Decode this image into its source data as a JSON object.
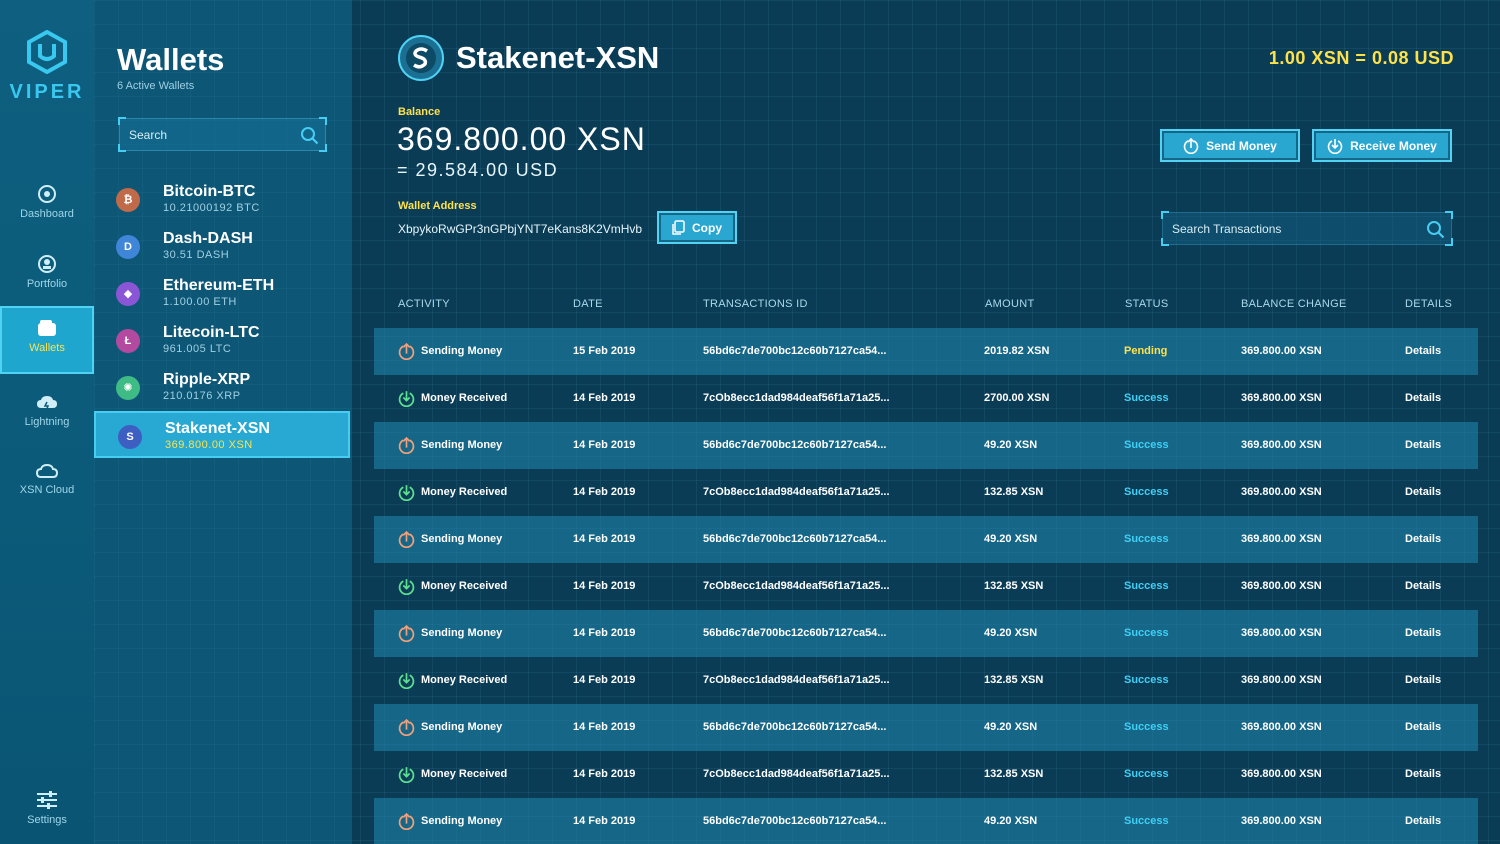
{
  "app": {
    "logo_text": "VIPER"
  },
  "nav": [
    {
      "label": "Dashboard",
      "icon": "dashboard-icon"
    },
    {
      "label": "Portfolio",
      "icon": "portfolio-icon"
    },
    {
      "label": "Wallets",
      "icon": "wallet-icon",
      "active": true
    },
    {
      "label": "Lightning",
      "icon": "lightning-cloud-icon"
    },
    {
      "label": "XSN Cloud",
      "icon": "cloud-icon"
    },
    {
      "label": "Settings",
      "icon": "sliders-icon"
    }
  ],
  "wallets": {
    "title": "Wallets",
    "subtitle": "6 Active Wallets",
    "search_placeholder": "Search",
    "items": [
      {
        "name": "Bitcoin-BTC",
        "balance": "10.21000192 BTC",
        "glyph": "₿",
        "color": "#c06a4a"
      },
      {
        "name": "Dash-DASH",
        "balance": "30.51 DASH",
        "glyph": "D",
        "color": "#3f86d9"
      },
      {
        "name": "Ethereum-ETH",
        "balance": "1.100.00 ETH",
        "glyph": "◆",
        "color": "#8b56d6"
      },
      {
        "name": "Litecoin-LTC",
        "balance": "961.005 LTC",
        "glyph": "Ł",
        "color": "#b34aa0"
      },
      {
        "name": "Ripple-XRP",
        "balance": "210.0176 XRP",
        "glyph": "✺",
        "color": "#3fbb86"
      },
      {
        "name": "Stakenet-XSN",
        "balance": "369.800.00 XSN",
        "glyph": "S",
        "color": "#3e5fc2",
        "active": true
      }
    ]
  },
  "header": {
    "coin_name": "Stakenet-XSN",
    "rate": "1.00 XSN = 0.08 USD"
  },
  "balance": {
    "label": "Balance",
    "amount": "369.800.00 XSN",
    "usd": "= 29.584.00 USD"
  },
  "address": {
    "label": "Wallet Address",
    "value": "XbpykoRwGPr3nGPbjYNT7eKans8K2VmHvb",
    "copy_label": "Copy"
  },
  "actions": {
    "send_label": "Send Money",
    "receive_label": "Receive Money"
  },
  "tx_search_placeholder": "Search Transactions",
  "table": {
    "headers": [
      "ACTIVITY",
      "DATE",
      "TRANSACTIONS ID",
      "AMOUNT",
      "STATUS",
      "BALANCE CHANGE",
      "DETAILS"
    ],
    "rows": [
      {
        "activity": "Sending Money",
        "type": "send",
        "date": "15 Feb 2019",
        "txid": "56bd6c7de700bc12c60b7127ca54...",
        "amount": "2019.82 XSN",
        "status": "Pending",
        "balance": "369.800.00 XSN",
        "details": "Details"
      },
      {
        "activity": "Money Received",
        "type": "receive",
        "date": "14 Feb 2019",
        "txid": "7cOb8ecc1dad984deaf56f1a71a25...",
        "amount": "2700.00 XSN",
        "status": "Success",
        "balance": "369.800.00 XSN",
        "details": "Details"
      },
      {
        "activity": "Sending Money",
        "type": "send",
        "date": "14 Feb 2019",
        "txid": "56bd6c7de700bc12c60b7127ca54...",
        "amount": "49.20 XSN",
        "status": "Success",
        "balance": "369.800.00 XSN",
        "details": "Details"
      },
      {
        "activity": "Money Received",
        "type": "receive",
        "date": "14 Feb 2019",
        "txid": "7cOb8ecc1dad984deaf56f1a71a25...",
        "amount": "132.85 XSN",
        "status": "Success",
        "balance": "369.800.00 XSN",
        "details": "Details"
      },
      {
        "activity": "Sending Money",
        "type": "send",
        "date": "14 Feb 2019",
        "txid": "56bd6c7de700bc12c60b7127ca54...",
        "amount": "49.20 XSN",
        "status": "Success",
        "balance": "369.800.00 XSN",
        "details": "Details"
      },
      {
        "activity": "Money Received",
        "type": "receive",
        "date": "14 Feb 2019",
        "txid": "7cOb8ecc1dad984deaf56f1a71a25...",
        "amount": "132.85 XSN",
        "status": "Success",
        "balance": "369.800.00 XSN",
        "details": "Details"
      },
      {
        "activity": "Sending Money",
        "type": "send",
        "date": "14 Feb 2019",
        "txid": "56bd6c7de700bc12c60b7127ca54...",
        "amount": "49.20 XSN",
        "status": "Success",
        "balance": "369.800.00 XSN",
        "details": "Details"
      },
      {
        "activity": "Money Received",
        "type": "receive",
        "date": "14 Feb 2019",
        "txid": "7cOb8ecc1dad984deaf56f1a71a25...",
        "amount": "132.85 XSN",
        "status": "Success",
        "balance": "369.800.00 XSN",
        "details": "Details"
      },
      {
        "activity": "Sending Money",
        "type": "send",
        "date": "14 Feb 2019",
        "txid": "56bd6c7de700bc12c60b7127ca54...",
        "amount": "49.20 XSN",
        "status": "Success",
        "balance": "369.800.00 XSN",
        "details": "Details"
      },
      {
        "activity": "Money Received",
        "type": "receive",
        "date": "14 Feb 2019",
        "txid": "7cOb8ecc1dad984deaf56f1a71a25...",
        "amount": "132.85 XSN",
        "status": "Success",
        "balance": "369.800.00 XSN",
        "details": "Details"
      },
      {
        "activity": "Sending Money",
        "type": "send",
        "date": "14 Feb 2019",
        "txid": "56bd6c7de700bc12c60b7127ca54...",
        "amount": "49.20 XSN",
        "status": "Success",
        "balance": "369.800.00 XSN",
        "details": "Details"
      }
    ]
  },
  "colors": {
    "accent": "#2aa7d1",
    "highlight_yellow": "#ffe14a",
    "success": "#3fd0f5",
    "send_icon": "#f0a07a",
    "receive_icon": "#5fe08f"
  }
}
